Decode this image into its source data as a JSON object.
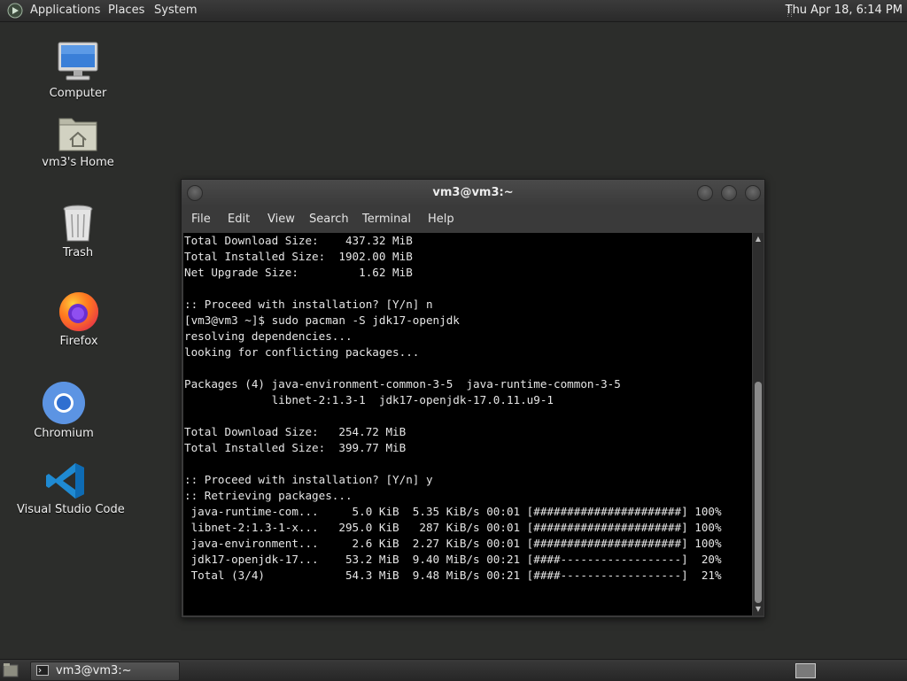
{
  "top_panel": {
    "menus": [
      "Applications",
      "Places",
      "System"
    ],
    "clock": "Thu Apr 18,  6:14 PM"
  },
  "desktop": {
    "icons": [
      {
        "label": "Computer",
        "icon": "computer-icon"
      },
      {
        "label": "vm3's Home",
        "icon": "home-folder-icon"
      },
      {
        "label": "Trash",
        "icon": "trash-icon"
      },
      {
        "label": "Firefox",
        "icon": "firefox-icon"
      },
      {
        "label": "Chromium",
        "icon": "chromium-icon"
      },
      {
        "label": "Visual Studio Code",
        "icon": "vscode-icon"
      }
    ]
  },
  "terminal": {
    "title": "vm3@vm3:~",
    "menu": [
      "File",
      "Edit",
      "View",
      "Search",
      "Terminal",
      "Help"
    ],
    "lines": [
      "Total Download Size:    437.32 MiB",
      "Total Installed Size:  1902.00 MiB",
      "Net Upgrade Size:         1.62 MiB",
      "",
      ":: Proceed with installation? [Y/n] n",
      "[vm3@vm3 ~]$ sudo pacman -S jdk17-openjdk",
      "resolving dependencies...",
      "looking for conflicting packages...",
      "",
      "Packages (4) java-environment-common-3-5  java-runtime-common-3-5",
      "             libnet-2:1.3-1  jdk17-openjdk-17.0.11.u9-1",
      "",
      "Total Download Size:   254.72 MiB",
      "Total Installed Size:  399.77 MiB",
      "",
      ":: Proceed with installation? [Y/n] y",
      ":: Retrieving packages...",
      " java-runtime-com...     5.0 KiB  5.35 KiB/s 00:01 [######################] 100%",
      " libnet-2:1.3-1-x...   295.0 KiB   287 KiB/s 00:01 [######################] 100%",
      " java-environment...     2.6 KiB  2.27 KiB/s 00:01 [######################] 100%",
      " jdk17-openjdk-17...    53.2 MiB  9.40 MiB/s 00:21 [####------------------]  20%",
      " Total (3/4)            54.3 MiB  9.48 MiB/s 00:21 [####------------------]  21%"
    ]
  },
  "taskbar": {
    "window_button": "vm3@vm3:~"
  }
}
